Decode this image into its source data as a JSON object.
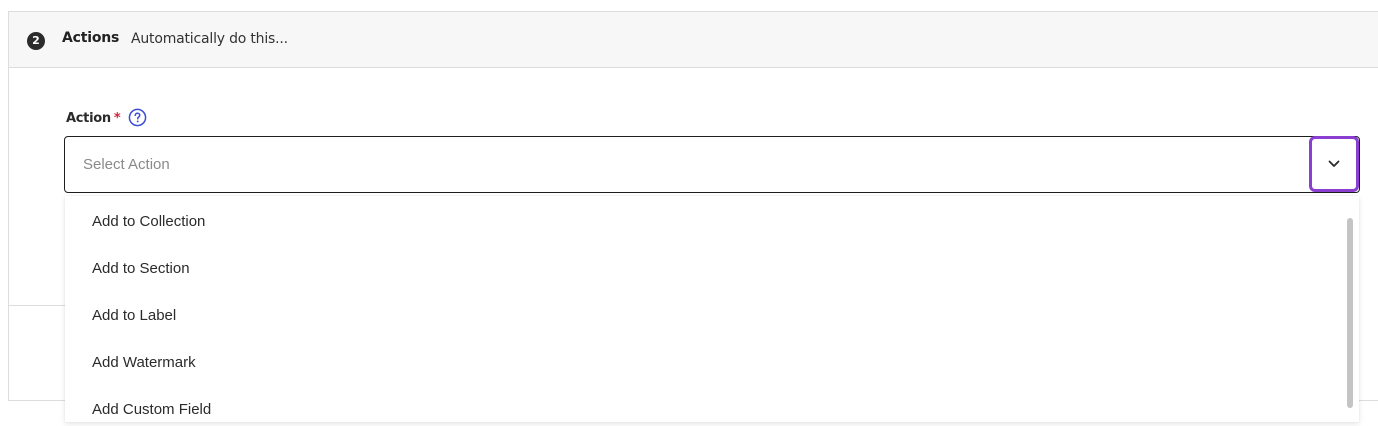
{
  "step": {
    "number": "2",
    "title": "Actions",
    "subtitle": "Automatically do this..."
  },
  "action_field": {
    "label": "Action",
    "required_marker": "*",
    "help_icon": "question-circle-icon",
    "placeholder": "Select Action",
    "toggle_icon": "chevron-down-icon",
    "toggle_focus_color": "#8a3fd1"
  },
  "dropdown": {
    "options": [
      {
        "label": "Add to Collection"
      },
      {
        "label": "Add to Section"
      },
      {
        "label": "Add to Label"
      },
      {
        "label": "Add Watermark"
      },
      {
        "label": "Add Custom Field"
      }
    ]
  },
  "colors": {
    "required": "#d0243a",
    "help_icon": "#3d4fd6",
    "focus_ring": "#8a3fd1"
  }
}
